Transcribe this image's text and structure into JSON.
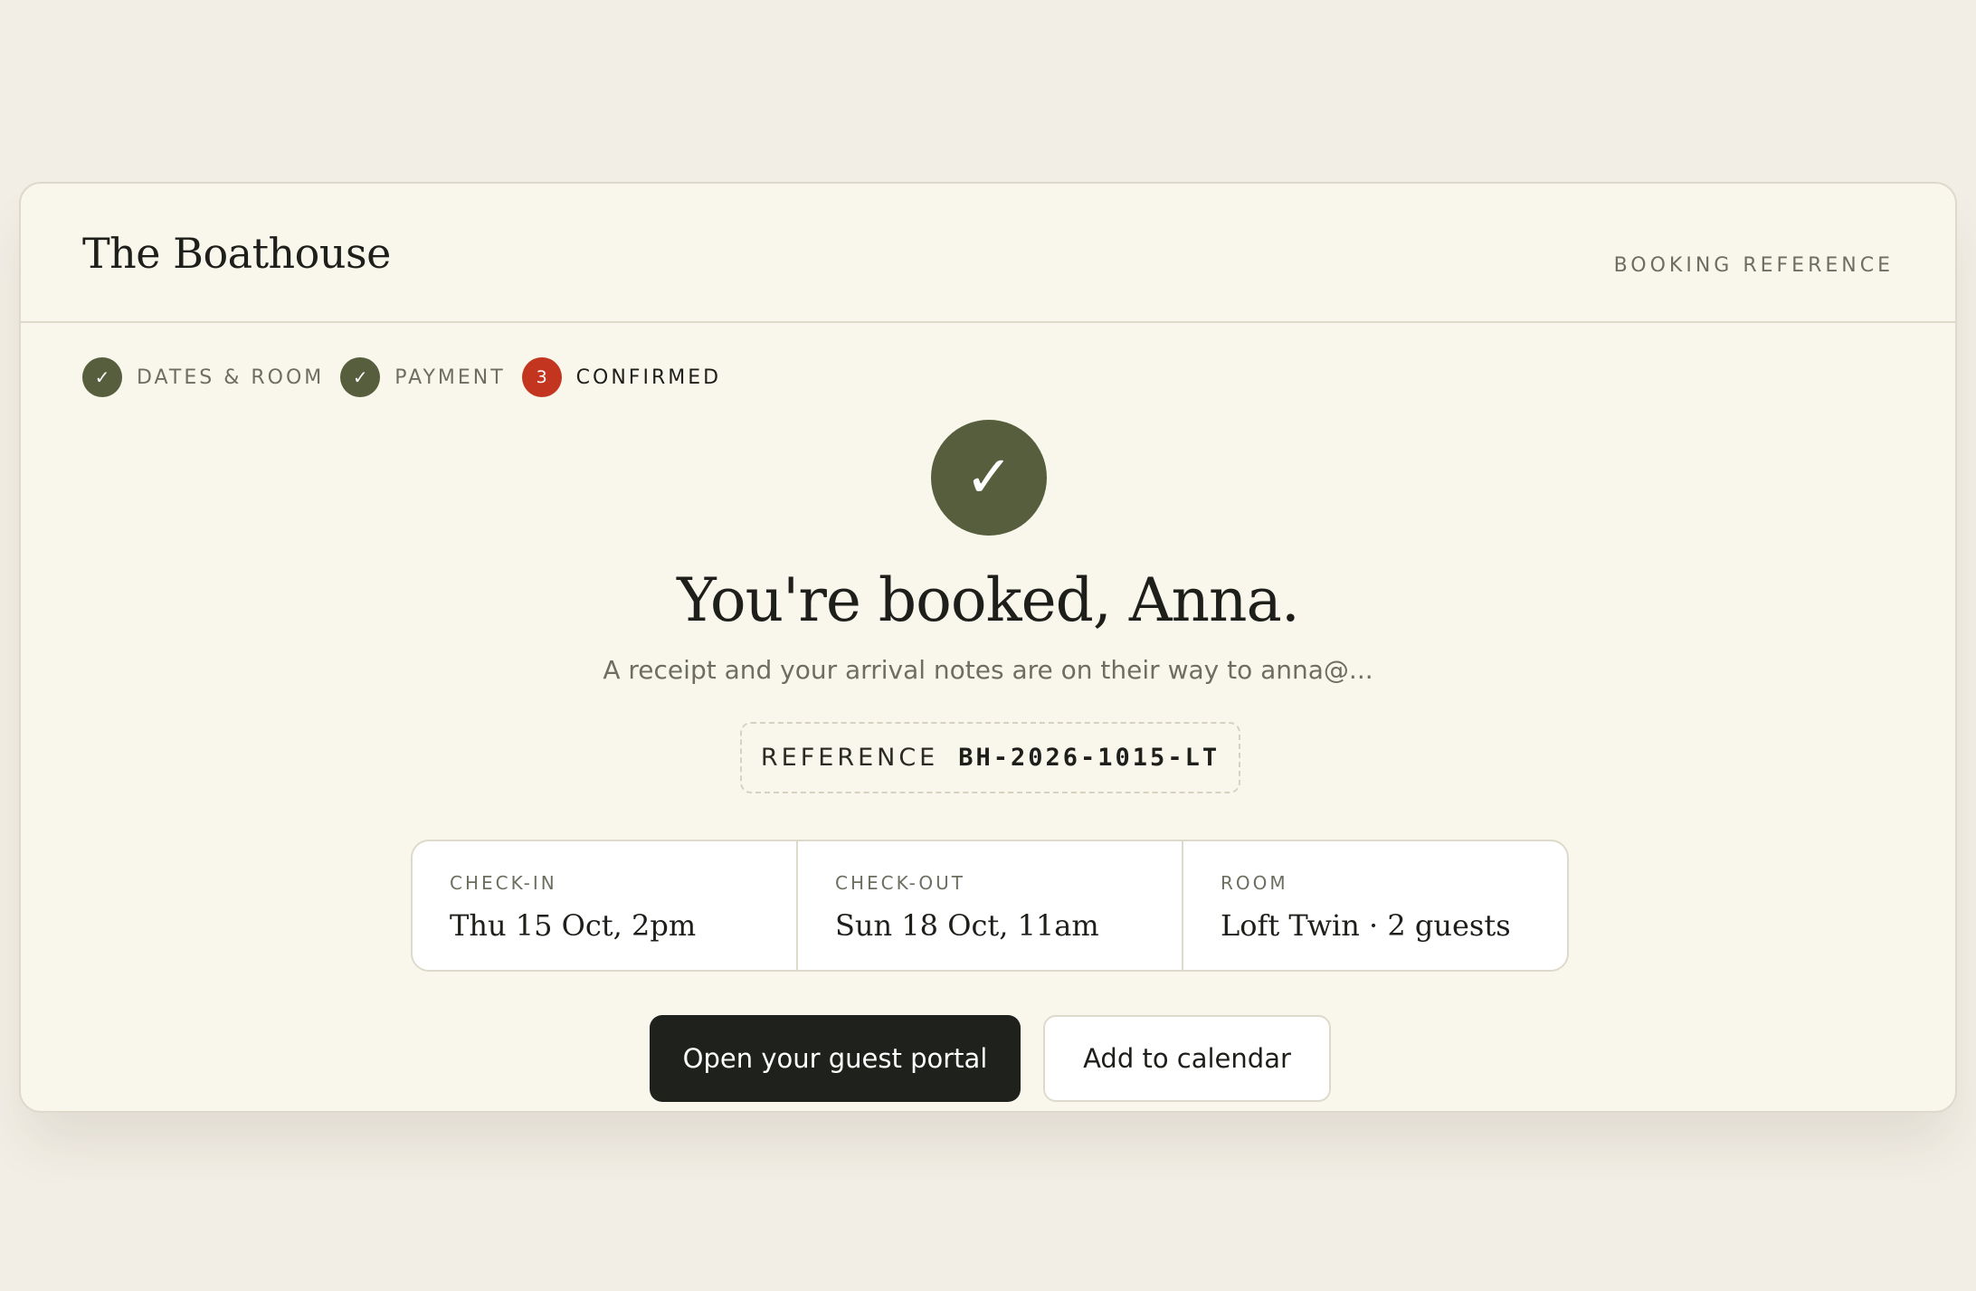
{
  "header": {
    "brand": "The Boathouse",
    "right_label": "BOOKING REFERENCE"
  },
  "steps": [
    {
      "mark": "✓",
      "label": "DATES & ROOM",
      "state": "done"
    },
    {
      "mark": "✓",
      "label": "PAYMENT",
      "state": "done"
    },
    {
      "mark": "3",
      "label": "CONFIRMED",
      "state": "active"
    }
  ],
  "confirmation": {
    "check_glyph": "✓",
    "headline": "You're booked, Anna.",
    "subline": "A receipt and your arrival notes are on their way to anna@...",
    "reference_label": "REFERENCE",
    "reference_code": "BH-2026-1015-LT"
  },
  "details": [
    {
      "label": "CHECK-IN",
      "value": "Thu 15 Oct, 2pm"
    },
    {
      "label": "CHECK-OUT",
      "value": "Sun 18 Oct, 11am"
    },
    {
      "label": "ROOM",
      "value": "Loft Twin · 2 guests"
    }
  ],
  "actions": {
    "primary_label": "Open your guest portal",
    "secondary_label": "Add to calendar"
  },
  "colors": {
    "background": "#f2eee5",
    "card": "#f9f7ec",
    "accent_green": "#565e3d",
    "accent_red": "#c3351f",
    "primary_button": "#1f211c"
  }
}
